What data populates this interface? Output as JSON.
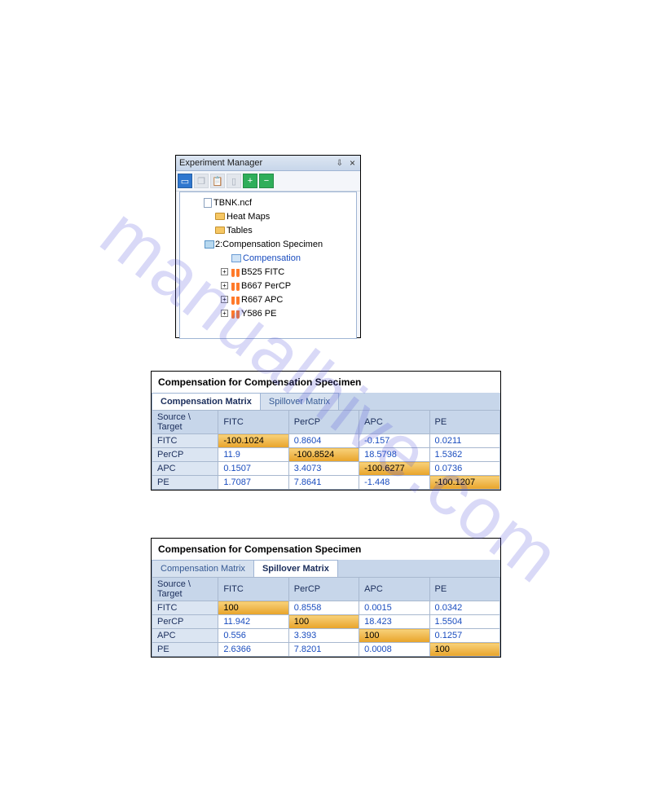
{
  "watermark": "manualhive.com",
  "experiment_manager": {
    "title": "Experiment Manager",
    "tree": [
      {
        "level": 0,
        "icon": "page",
        "label": "TBNK.ncf",
        "toggle": "",
        "selected": false
      },
      {
        "level": 1,
        "icon": "folder",
        "label": "Heat Maps",
        "toggle": "",
        "selected": false
      },
      {
        "level": 1,
        "icon": "folder",
        "label": "Tables",
        "toggle": "",
        "selected": false
      },
      {
        "level": 1,
        "icon": "panel",
        "label": "2:Compensation Specimen",
        "toggle": "−",
        "selected": false
      },
      {
        "level": 2,
        "icon": "matrix",
        "label": "Compensation",
        "toggle": "",
        "selected": true
      },
      {
        "level": 2,
        "icon": "tube",
        "label": "B525 FITC",
        "toggle": "+",
        "selected": false
      },
      {
        "level": 2,
        "icon": "tube",
        "label": "B667 PerCP",
        "toggle": "+",
        "selected": false
      },
      {
        "level": 2,
        "icon": "tube",
        "label": "R667 APC",
        "toggle": "+",
        "selected": false
      },
      {
        "level": 2,
        "icon": "tube",
        "label": "Y586 PE",
        "toggle": "+",
        "selected": false
      }
    ]
  },
  "table1": {
    "title": "Compensation for Compensation Specimen",
    "tabs": {
      "a": "Compensation Matrix",
      "b": "Spillover Matrix"
    },
    "corner": "Source \\ Target",
    "cols": [
      "FITC",
      "PerCP",
      "APC",
      "PE"
    ],
    "rows": [
      {
        "h": "FITC",
        "c": [
          "-100.1024",
          "0.8604",
          "-0.157",
          "0.0211"
        ]
      },
      {
        "h": "PerCP",
        "c": [
          "11.9",
          "-100.8524",
          "18.5798",
          "1.5362"
        ]
      },
      {
        "h": "APC",
        "c": [
          "0.1507",
          "3.4073",
          "-100.6277",
          "0.0736"
        ]
      },
      {
        "h": "PE",
        "c": [
          "1.7087",
          "7.8641",
          "-1.448",
          "-100.1207"
        ]
      }
    ]
  },
  "table2": {
    "title": "Compensation for Compensation Specimen",
    "tabs": {
      "a": "Compensation Matrix",
      "b": "Spillover Matrix"
    },
    "corner": "Source \\ Target",
    "cols": [
      "FITC",
      "PerCP",
      "APC",
      "PE"
    ],
    "rows": [
      {
        "h": "FITC",
        "c": [
          "100",
          "0.8558",
          "0.0015",
          "0.0342"
        ]
      },
      {
        "h": "PerCP",
        "c": [
          "11.942",
          "100",
          "18.423",
          "1.5504"
        ]
      },
      {
        "h": "APC",
        "c": [
          "0.556",
          "3.393",
          "100",
          "0.1257"
        ]
      },
      {
        "h": "PE",
        "c": [
          "2.6366",
          "7.8201",
          "0.0008",
          "100"
        ]
      }
    ]
  }
}
